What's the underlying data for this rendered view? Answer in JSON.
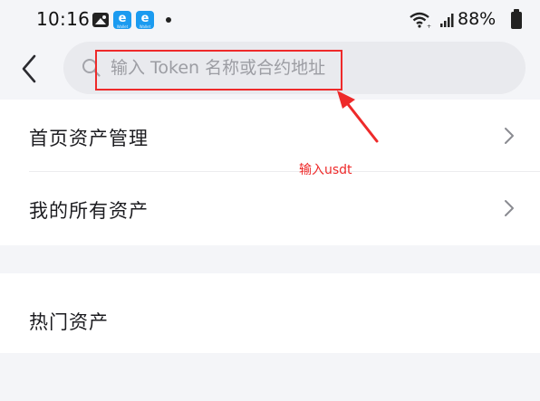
{
  "status_bar": {
    "time": "10:16",
    "left_icons": [
      "image-icon",
      "wallet-app-icon",
      "wallet-app-icon",
      "notification-dot-icon"
    ],
    "app_icon_glyph": "e",
    "battery_percent": "88%",
    "right_icons": [
      "wifi-icon",
      "signal-icon",
      "battery-icon"
    ]
  },
  "nav": {
    "back_icon": "chevron-left-icon",
    "search": {
      "placeholder": "输入 Token 名称或合约地址",
      "value": "",
      "icon": "search-icon"
    }
  },
  "menu": {
    "items": [
      {
        "label": "首页资产管理",
        "icon": "chevron-right-icon"
      },
      {
        "label": "我的所有资产",
        "icon": "chevron-right-icon"
      }
    ]
  },
  "sections": {
    "hot_assets_title": "热门资产"
  },
  "annotation": {
    "text": "输入usdt",
    "color": "#ee2a2a"
  },
  "colors": {
    "background": "#f4f5f8",
    "card": "#ffffff",
    "search_bg": "#e9eaee",
    "placeholder": "#9c9da3"
  }
}
